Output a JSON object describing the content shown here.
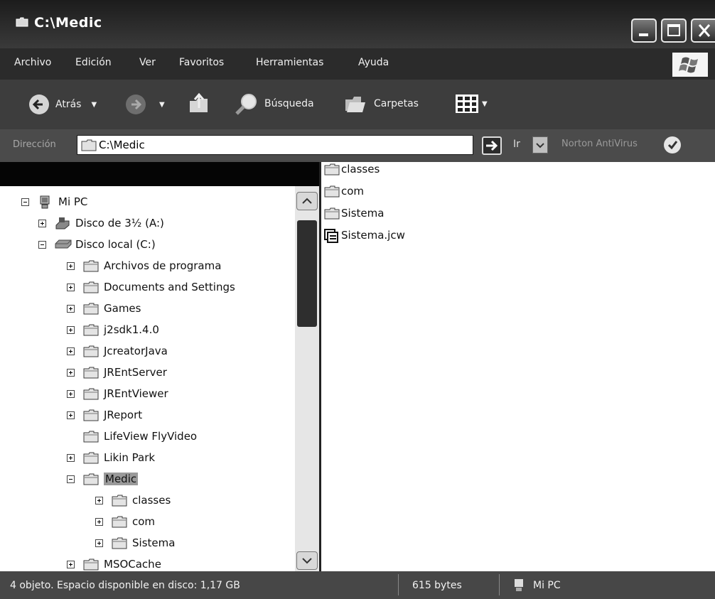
{
  "window": {
    "title": "C:\\Medic"
  },
  "menu": [
    "Archivo",
    "Edición",
    "Ver",
    "Favoritos",
    "Herramientas",
    "Ayuda"
  ],
  "toolbar": {
    "back_label": "Atrás",
    "search_label": "Búsqueda",
    "folders_label": "Carpetas"
  },
  "address": {
    "label": "Dirección",
    "value": "C:\\Medic",
    "go_label": "Ir",
    "norton_label": "Norton AntiVirus"
  },
  "tree": [
    {
      "label": "Mi PC",
      "level": 0,
      "expander": "minus",
      "icon": "computer-icon"
    },
    {
      "label": "Disco de 3½ (A:)",
      "level": 1,
      "expander": "plus",
      "icon": "floppy-drive-icon"
    },
    {
      "label": "Disco local (C:)",
      "level": 1,
      "expander": "minus",
      "icon": "hard-drive-icon"
    },
    {
      "label": "Archivos de programa",
      "level": 2,
      "expander": "plus",
      "icon": "folder-icon"
    },
    {
      "label": "Documents and Settings",
      "level": 2,
      "expander": "plus",
      "icon": "folder-icon"
    },
    {
      "label": "Games",
      "level": 2,
      "expander": "plus",
      "icon": "folder-icon"
    },
    {
      "label": "j2sdk1.4.0",
      "level": 2,
      "expander": "plus",
      "icon": "folder-icon"
    },
    {
      "label": "JcreatorJava",
      "level": 2,
      "expander": "plus",
      "icon": "folder-icon"
    },
    {
      "label": "JREntServer",
      "level": 2,
      "expander": "plus",
      "icon": "folder-icon"
    },
    {
      "label": "JREntViewer",
      "level": 2,
      "expander": "plus",
      "icon": "folder-icon"
    },
    {
      "label": "JReport",
      "level": 2,
      "expander": "plus",
      "icon": "folder-icon"
    },
    {
      "label": "LifeView FlyVideo",
      "level": 2,
      "expander": "none",
      "icon": "folder-icon"
    },
    {
      "label": "Likin Park",
      "level": 2,
      "expander": "plus",
      "icon": "folder-icon"
    },
    {
      "label": "Medic",
      "level": 2,
      "expander": "minus",
      "icon": "folder-icon",
      "selected": true
    },
    {
      "label": "classes",
      "level": 3,
      "expander": "plus",
      "icon": "folder-icon"
    },
    {
      "label": "com",
      "level": 3,
      "expander": "plus",
      "icon": "folder-icon"
    },
    {
      "label": "Sistema",
      "level": 3,
      "expander": "plus",
      "icon": "folder-icon"
    },
    {
      "label": "MSOCache",
      "level": 2,
      "expander": "plus",
      "icon": "folder-icon"
    }
  ],
  "files": [
    {
      "name": "classes",
      "icon": "folder-icon"
    },
    {
      "name": "com",
      "icon": "folder-icon"
    },
    {
      "name": "Sistema",
      "icon": "folder-icon"
    },
    {
      "name": "Sistema.jcw",
      "icon": "jcw-file-icon"
    }
  ],
  "status": {
    "objects": "4 objeto. Espacio disponible en disco:  1,17 GB",
    "size": "615 bytes",
    "location": "Mi PC"
  },
  "colors": {
    "titlebar": "#2a2a2a",
    "menubar": "#2b2b2b",
    "selection": "#9a9a9a",
    "folder": "#d8d8d8"
  }
}
